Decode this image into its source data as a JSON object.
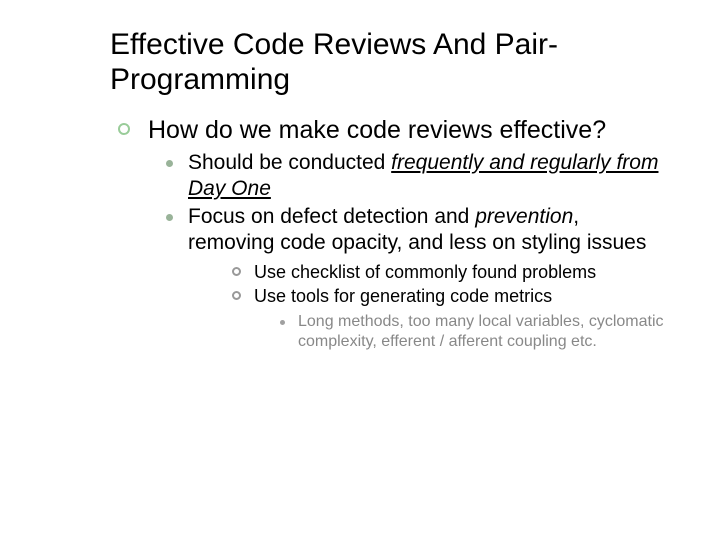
{
  "title": "Effective Code Reviews And Pair-Programming",
  "lvl1": {
    "q": "How do we make code reviews effective?"
  },
  "lvl2": {
    "a_pre": "Should be conducted ",
    "a_em": "frequently and regularly from Day One",
    "b_pre": "Focus on defect detection and ",
    "b_em": "prevention",
    "b_post": ", removing code opacity, and less on styling issues"
  },
  "lvl3": {
    "a": "Use checklist of commonly found problems",
    "b": "Use tools for generating code metrics"
  },
  "lvl4": {
    "a": "Long methods, too many local variables, cyclomatic complexity, efferent / afferent coupling etc."
  }
}
